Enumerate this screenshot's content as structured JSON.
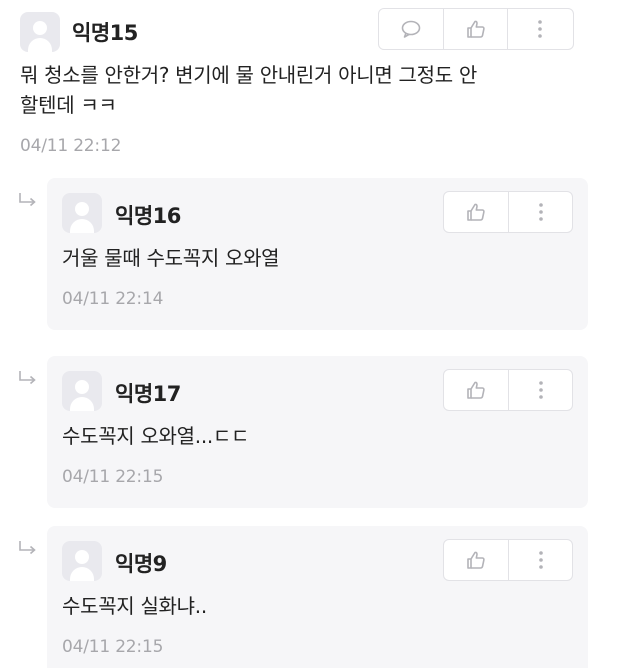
{
  "comment": {
    "author": "익명15",
    "body_line1": "뭐 청소를 안한거? 변기에 물 안내린거 아니면 그정도 안",
    "body_line2": "할텐데 ㅋㅋ",
    "time": "04/11 22:12",
    "actions": [
      "speech-bubble-icon",
      "thumbs-up-icon",
      "more-vertical-icon"
    ]
  },
  "replies": [
    {
      "author": "익명16",
      "body": "거울 물때 수도꼭지 오와열",
      "time": "04/11 22:14"
    },
    {
      "author": "익명17",
      "body": "수도꼭지 오와열...ㄷㄷ",
      "time": "04/11 22:15"
    },
    {
      "author": "익명9",
      "body": "수도꼭지 실화냐..",
      "time": "04/11 22:15"
    }
  ],
  "colors": {
    "reply_bg": "#f6f6f8",
    "border": "#e2e2e6",
    "time_text": "#a7a7ab",
    "icon": "#b3b3b8"
  }
}
